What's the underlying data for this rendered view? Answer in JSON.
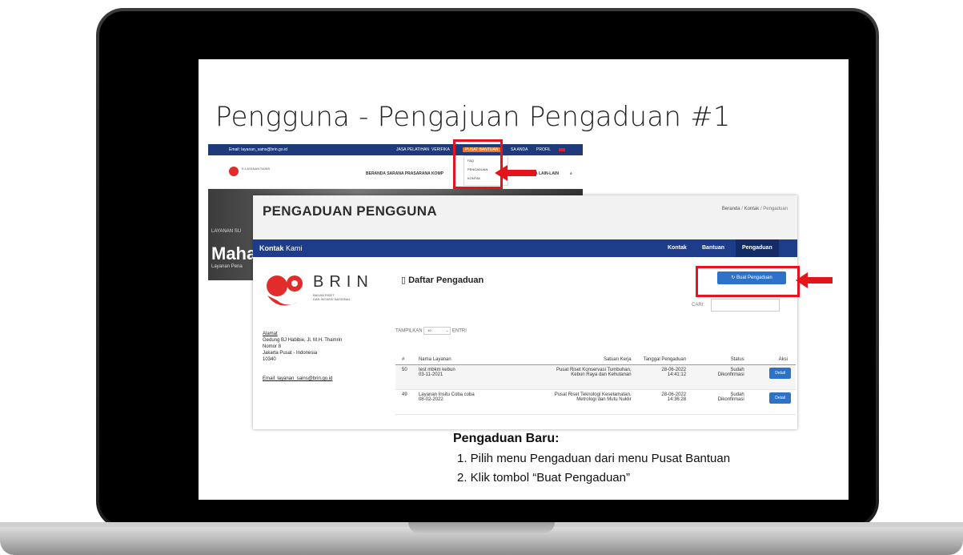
{
  "slide": {
    "title": "Pengguna - Pengajuan Pengaduan #1"
  },
  "site": {
    "topbar_email": "Email: layanan_sains@brin.go.id",
    "topbar_items": [
      "JASA PELATIHAN",
      "VERIFIKA",
      "PUSAT BANTUAN",
      "SA ANDA",
      "PROFIL"
    ],
    "logo_text": "E-LAYANAN SAINS",
    "menu_left": "BERANDA  SARANA PRASARANA  KOMP",
    "menu_right": "MA  LAIN-LAIN",
    "dropdown_items": [
      "FAQ",
      "PENGADUAN",
      "KONTAK"
    ],
    "hero_small": "LAYANAN SU",
    "hero_text": "Maha",
    "hero_sub": "Layanan Pena"
  },
  "page": {
    "header_title": "PENGADUAN PENGGUNA",
    "breadcrumb": [
      "Beranda",
      "Kontak",
      "Pengaduan"
    ],
    "bluebar_bold": "Kontak",
    "bluebar_rest": " Kami",
    "tabs": [
      "Kontak",
      "Bantuan",
      "Pengaduan"
    ],
    "brin_word": "BRIN",
    "brin_sub_1": "BADAN RISET",
    "brin_sub_2": "DAN INOVASI NASIONAL",
    "address_label": "Alamat",
    "address_lines": [
      "Gedung BJ Habibie, Jl. M.H. Thamrin",
      "Nomor 8",
      "Jakarta Pusat - Indonesia",
      "10340"
    ],
    "email": "Email: layanan_sains@brin.go.id",
    "list_title": "Daftar Pengaduan",
    "buat_button": "Buat Pengaduan",
    "cari_label": "CARI:",
    "tampilkan": "TAMPILKAN",
    "entries_value": "10",
    "entri": "ENTRI",
    "table": {
      "headers": [
        "#",
        "Nama Layanan",
        "Satuan Kerja",
        "Tanggal Pengaduan",
        "Status",
        "Aksi"
      ],
      "rows": [
        {
          "no": "50",
          "nama": "test mbkm kebun",
          "nama_date": "03-11-2021",
          "satuan_1": "Pusat Riset Konservasi Tumbuhan,",
          "satuan_2": "Kebun Raya dan Kehutanan",
          "tanggal": "28-06-2022",
          "jam": "14:41:12",
          "status_1": "Sudah",
          "status_2": "Dikonfirmasi",
          "aksi": "Detail"
        },
        {
          "no": "49",
          "nama": "Layanan Insitu Coba coba",
          "nama_date": "08-02-2022",
          "satuan_1": "Pusat Riset Teknologi Keselamatan,",
          "satuan_2": "Metrologi dan Mutu Nuklir",
          "tanggal": "28-06-2022",
          "jam": "14:36:28",
          "status_1": "Sudah",
          "status_2": "Dikonfirmasi",
          "aksi": "Detail"
        }
      ]
    }
  },
  "instructions": {
    "title": "Pengaduan Baru:",
    "items": [
      "1.  Pilih menu Pengaduan dari menu Pusat Bantuan",
      "2.  Klik tombol “Buat Pengaduan”"
    ]
  },
  "colors": {
    "brand_blue": "#1d3c8a",
    "button_blue": "#2c72c9",
    "highlight_red": "#e3141b",
    "brin_red": "#e22b2b"
  }
}
